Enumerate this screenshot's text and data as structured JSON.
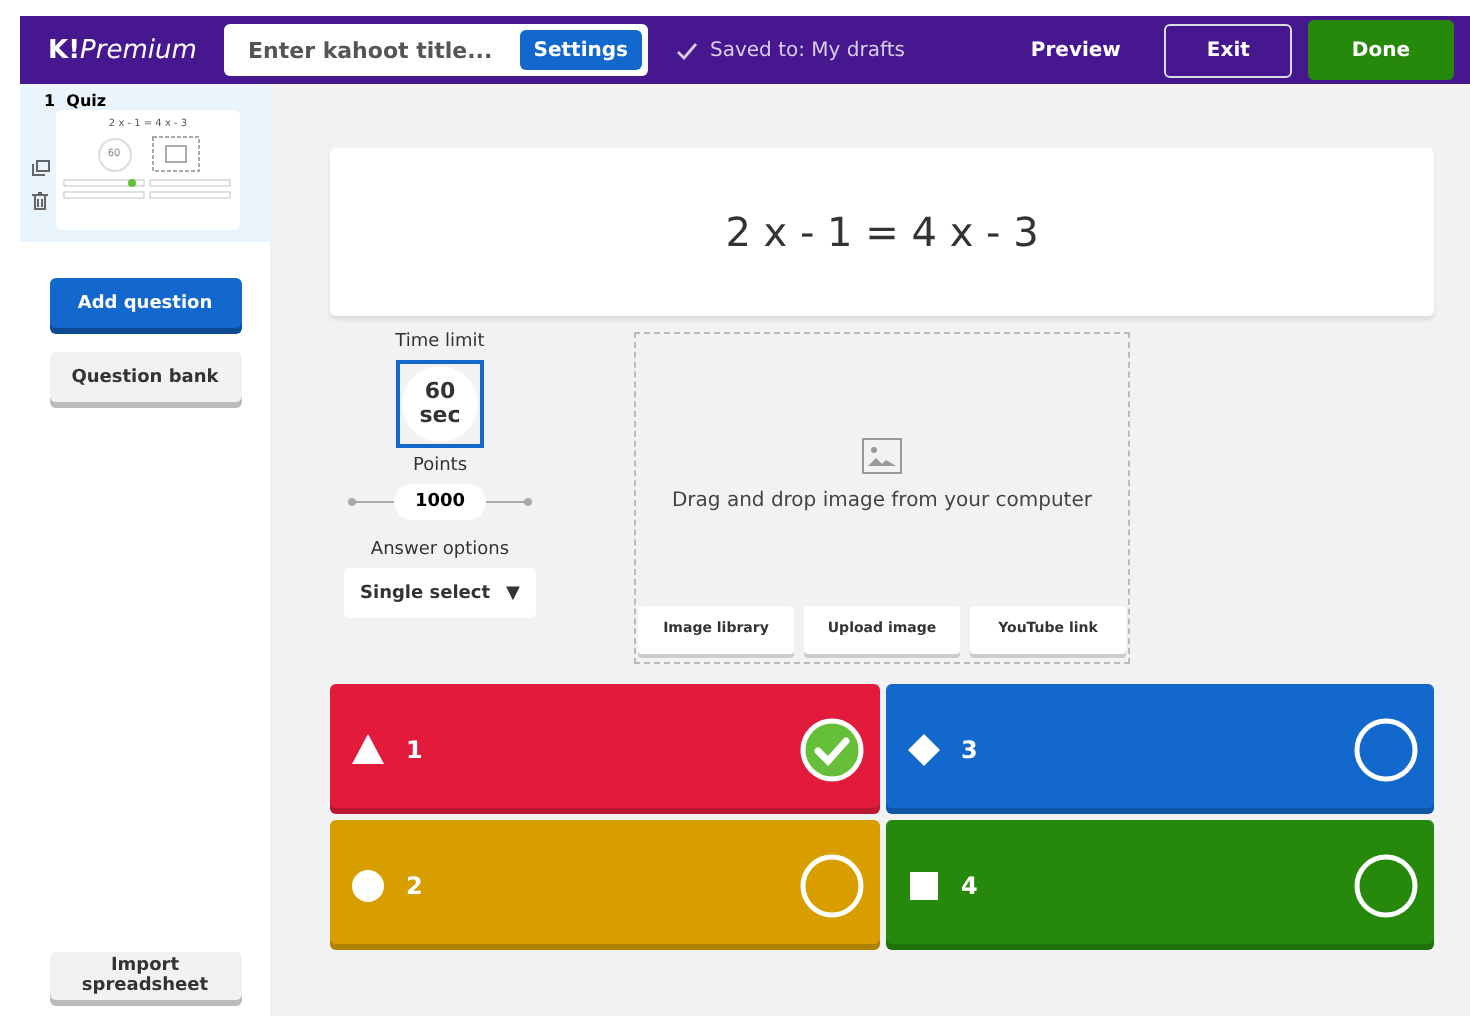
{
  "topbar": {
    "logo_mark": "K!",
    "logo_text": "Premium",
    "title_placeholder": "Enter kahoot title...",
    "settings": "Settings",
    "saved": "Saved to: My drafts",
    "preview": "Preview",
    "exit": "Exit",
    "done": "Done"
  },
  "sidebar": {
    "slides": [
      {
        "number": "1",
        "type": "Quiz",
        "question": "2 x - 1 = 4 x - 3",
        "time": "60",
        "selected": true
      }
    ],
    "add_question": "Add question",
    "question_bank": "Question bank",
    "import": "Import spreadsheet"
  },
  "question": "2 x - 1 = 4 x - 3",
  "settings": {
    "time_label": "Time limit",
    "time_value": "60",
    "time_unit": "sec",
    "points_label": "Points",
    "points_value": "1000",
    "answer_options_label": "Answer options",
    "answer_options_value": "Single select",
    "caret": "▼"
  },
  "media": {
    "hint": "Drag and drop image from your computer",
    "buttons": [
      "Image library",
      "Upload image",
      "YouTube link"
    ]
  },
  "answers": [
    {
      "text": "1",
      "kind": "triangle",
      "color": "#e21b3c",
      "correct": true
    },
    {
      "text": "3",
      "kind": "diamond",
      "color": "#1368ce",
      "correct": false
    },
    {
      "text": "2",
      "kind": "circle",
      "color": "#d89e00",
      "correct": false
    },
    {
      "text": "4",
      "kind": "square",
      "color": "#26890c",
      "correct": false
    }
  ]
}
